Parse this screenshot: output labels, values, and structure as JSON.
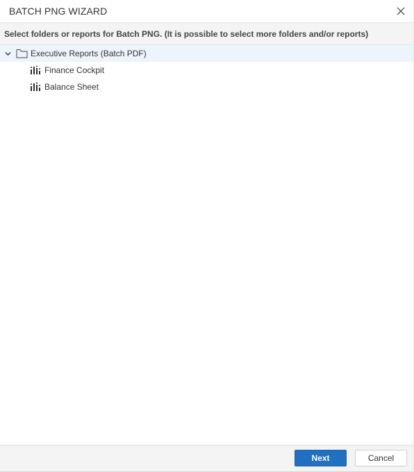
{
  "dialog": {
    "title": "BATCH PNG WIZARD",
    "close_icon": "close-icon",
    "instructions": "Select folders or reports for Batch PNG. (It is possible to select more folders and/or reports)"
  },
  "tree": {
    "folder": {
      "label": "Executive Reports (Batch PDF)",
      "icon": "folder-icon",
      "expanded": true,
      "children": [
        {
          "label": "Finance Cockpit",
          "icon": "report-chart-icon"
        },
        {
          "label": "Balance Sheet",
          "icon": "report-chart-icon"
        }
      ]
    }
  },
  "footer": {
    "next_label": "Next",
    "cancel_label": "Cancel"
  },
  "colors": {
    "primary": "#1f70c1",
    "panel_bg": "#f4f4f4",
    "selected_row": "#eef4fb"
  }
}
